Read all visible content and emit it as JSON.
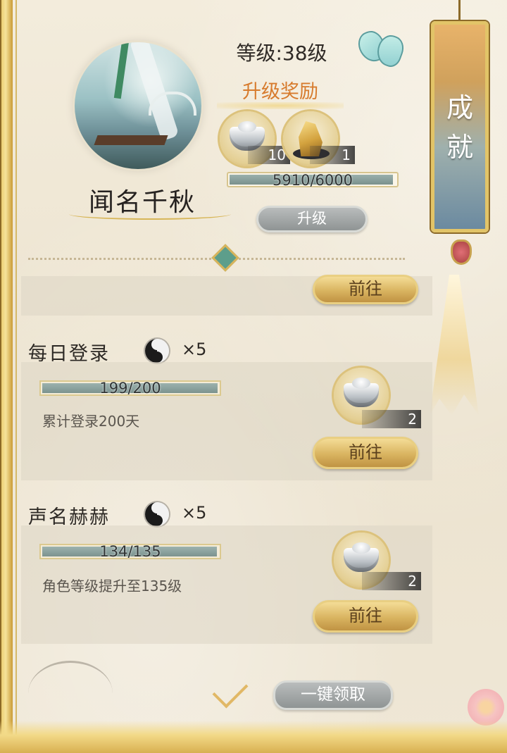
{
  "player": {
    "name": "闻名千秋",
    "level_text": "等级:38级"
  },
  "level_reward": {
    "title": "升级奖励",
    "items": [
      {
        "icon": "silver-ingot-icon",
        "count": "10"
      },
      {
        "icon": "gold-ore-icon",
        "count": "1"
      }
    ],
    "exp_text": "5910/6000",
    "exp_progress": 0.985,
    "upgrade_button": "升级"
  },
  "side_tab": {
    "label": "成就"
  },
  "partial_task": {
    "go_button": "前往"
  },
  "tasks": [
    {
      "title": "每日登录",
      "reward_multiplier": "×5",
      "progress_text": "199/200",
      "progress": 0.995,
      "description": "累计登录200天",
      "item_count": "2",
      "go_button": "前往"
    },
    {
      "title": "声名赫赫",
      "reward_multiplier": "×5",
      "progress_text": "134/135",
      "progress": 0.993,
      "description": "角色等级提升至135级",
      "item_count": "2",
      "go_button": "前往"
    }
  ],
  "footer": {
    "claim_all_button": "一键领取"
  },
  "colors": {
    "accent_gold": "#d9b460",
    "reward_title_orange": "#d77b2d",
    "progress_fill": "#7c938f"
  }
}
